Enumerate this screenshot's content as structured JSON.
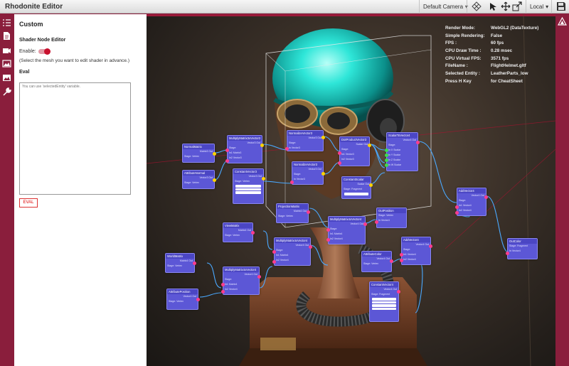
{
  "app": {
    "title": "Rhodonite Editor"
  },
  "toolbar": {
    "camera_select": "Default Camera",
    "space_select": "Local",
    "icons": [
      "grid-icon",
      "cursor-icon",
      "move-icon",
      "scale-icon",
      "save-icon"
    ]
  },
  "sidebar": {
    "icons": [
      "list-icon",
      "document-icon",
      "camera-icon",
      "image-icon",
      "landscape-icon",
      "tools-icon"
    ]
  },
  "panel": {
    "title": "Custom",
    "subtitle": "Shader Node Editor",
    "enable_label": "Enable:",
    "enable_on": true,
    "hint": "(Select the mesh you want to edit shader in advance.)",
    "eval_heading": "Eval",
    "eval_placeholder": "You can use 'selectedEntity' variable.",
    "eval_button": "EVAL"
  },
  "stats": [
    {
      "key": "Render Mode:",
      "value": "WebGL2 (DataTexture)"
    },
    {
      "key": "Simple Rendering:",
      "value": "False"
    },
    {
      "key": "FPS :",
      "value": "60 fps"
    },
    {
      "key": "CPU Draw Time :",
      "value": "0.28 msec"
    },
    {
      "key": "CPU Virtual FPS:",
      "value": "3571 fps"
    },
    {
      "key": "FileName :",
      "value": "FlightHelmet.gltf"
    },
    {
      "key": "Selected Entity :",
      "value": "LeatherParts_low"
    },
    {
      "key": "Press H Key",
      "value": "for CheatSheet"
    }
  ],
  "nodes": {
    "normalmatrix": {
      "title": "NormalMatrix",
      "out": "Matrix3 Out",
      "stage": "Stage: Vertex"
    },
    "attrnormal": {
      "title": "AttributeNormal",
      "out": "Vector3 Out",
      "stage": "Stage: Vertex"
    },
    "mulmat3vec3": {
      "title": "MultiplyMatrix3xVector3",
      "out": "Vector3 Out",
      "stage": "Stage:",
      "in1": "In1 Matrix3",
      "in2": "In2 Vector3"
    },
    "constvec3": {
      "title": "ConstantVector3",
      "out": "Vector3 Out",
      "stage": "Stage: Vertex"
    },
    "normalize1": {
      "title": "NormalizeVector3",
      "out": "Vector3 Out",
      "stage": "Stage:",
      "in": "In Vector3"
    },
    "normalize2": {
      "title": "NormalizeVector3",
      "out": "Vector3 Out",
      "stage": "Stage:",
      "in": "In Vector3"
    },
    "dotproduct": {
      "title": "DotProductVector3",
      "out": "Scalar Out",
      "stage": "Stage:",
      "in1": "In1 Vector3",
      "in2": "In2 Vector3"
    },
    "constscalar": {
      "title": "ConstantScalar",
      "out": "Scalar Out",
      "stage": "Stage: Fragment"
    },
    "scalartovec4": {
      "title": "ScalarToVector4",
      "out": "Vector4 Out",
      "stage": "Stage:",
      "x": "In X Scalar",
      "y": "In Y Scalar",
      "z": "In Z Scalar",
      "w": "In W Scalar"
    },
    "addvec4_top": {
      "title": "AddVector4",
      "out": "Vector4 Out",
      "stage": "Stage:",
      "in1": "In1 Vector4",
      "in2": "In2 Vector4"
    },
    "projmatrix": {
      "title": "ProjectionMatrix",
      "out": "Matrix4 Out",
      "stage": "Stage: Vertex"
    },
    "mulmat4vec4_mid": {
      "title": "MultiplyMatrix4xVector4",
      "out": "Vector4 Out",
      "stage": "Stage:",
      "in1": "In1 Matrix4",
      "in2": "In2 Vector4"
    },
    "outpos": {
      "title": "OutPosition",
      "stage": "Stage: Vertex",
      "in": "In Vector4"
    },
    "viewmatrix": {
      "title": "ViewMatrix",
      "out": "Matrix4 Out",
      "stage": "Stage: Vertex"
    },
    "mulmat4vec4_low": {
      "title": "MultiplyMatrix4xVector4",
      "out": "Vector4 Out",
      "stage": "Stage:",
      "in1": "In1 Matrix4",
      "in2": "In2 Vector4"
    },
    "attrcolor": {
      "title": "AttributeColor",
      "out": "Vector4 Out",
      "stage": "Stage: Vertex"
    },
    "addvec4_low": {
      "title": "AddVector4",
      "out": "Vector4 Out",
      "stage": "Stage:",
      "in1": "In1 Vector4",
      "in2": "In2 Vector4"
    },
    "worldmatrix": {
      "title": "WorldMatrix",
      "out": "Matrix4 Out",
      "stage": "Stage: Vertex"
    },
    "mulmat4vec4_bot": {
      "title": "MultiplyMatrix4xVector4",
      "out": "Vector4 Out",
      "stage": "Stage:",
      "in1": "In1 Matrix4",
      "in2": "In2 Vector4"
    },
    "attrpos": {
      "title": "AttributePosition",
      "out": "Vector4 Out",
      "stage": "Stage: Vertex"
    },
    "constvec4": {
      "title": "ConstantVector4",
      "out": "Vector4 Out",
      "stage": "Stage: Fragment"
    },
    "outcolor": {
      "title": "OutColor",
      "stage": "Stage: Fragment",
      "in": "In Vector4"
    }
  },
  "colors": {
    "brand": "#8a1e3c",
    "node": "#5c57d6",
    "socket_in": "#ff3d8f",
    "socket_out": "#ffd400",
    "accent_red": "#c8102e"
  }
}
